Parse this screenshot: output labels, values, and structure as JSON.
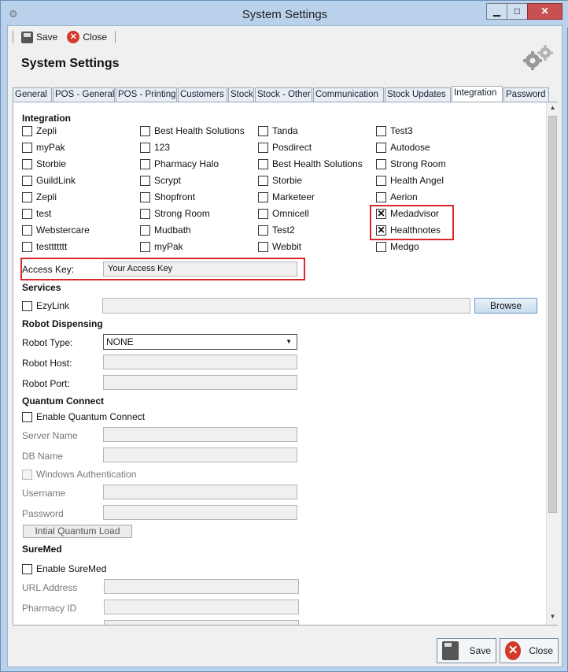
{
  "window": {
    "title": "System Settings"
  },
  "toolbar": {
    "save_label": "Save",
    "close_label": "Close"
  },
  "header": {
    "title": "System Settings"
  },
  "tabs": [
    "General",
    "POS - General",
    "POS - Printing",
    "Customers",
    "Stock",
    "Stock - Other",
    "Communication",
    "Stock Updates",
    "Integration",
    "Password"
  ],
  "active_tab": "Integration",
  "integration": {
    "heading": "Integration",
    "columns": [
      [
        {
          "label": "Zepli",
          "checked": false
        },
        {
          "label": "myPak",
          "checked": false
        },
        {
          "label": "Storbie",
          "checked": false
        },
        {
          "label": "GuildLink",
          "checked": false
        },
        {
          "label": "Zepli",
          "checked": false
        },
        {
          "label": "test",
          "checked": false
        },
        {
          "label": "Webstercare",
          "checked": false
        },
        {
          "label": "testtttttt",
          "checked": false
        }
      ],
      [
        {
          "label": "Best Health Solutions",
          "checked": false
        },
        {
          "label": "123",
          "checked": false
        },
        {
          "label": "Pharmacy Halo",
          "checked": false
        },
        {
          "label": "Scrypt",
          "checked": false
        },
        {
          "label": "Shopfront",
          "checked": false
        },
        {
          "label": "Strong Room",
          "checked": false
        },
        {
          "label": "Mudbath",
          "checked": false
        },
        {
          "label": "myPak",
          "checked": false
        }
      ],
      [
        {
          "label": "Tanda",
          "checked": false
        },
        {
          "label": "Posdirect",
          "checked": false
        },
        {
          "label": "Best Health Solutions",
          "checked": false
        },
        {
          "label": "Storbie",
          "checked": false
        },
        {
          "label": "Marketeer",
          "checked": false
        },
        {
          "label": "Omnicell",
          "checked": false
        },
        {
          "label": "Test2",
          "checked": false
        },
        {
          "label": "Webbit",
          "checked": false
        }
      ],
      [
        {
          "label": "Test3",
          "checked": false
        },
        {
          "label": "Autodose",
          "checked": false
        },
        {
          "label": "Strong Room",
          "checked": false
        },
        {
          "label": "Health Angel",
          "checked": false
        },
        {
          "label": "Aerion",
          "checked": false
        },
        {
          "label": "Medadvisor",
          "checked": true
        },
        {
          "label": "Healthnotes",
          "checked": true
        },
        {
          "label": "Medgo",
          "checked": false
        }
      ]
    ],
    "access_key_label": "Access Key:",
    "access_key_value": "Your Access Key"
  },
  "services": {
    "heading": "Services",
    "ezylink_label": "EzyLink",
    "ezylink_checked": false,
    "ezylink_path": "",
    "browse_label": "Browse"
  },
  "robot": {
    "heading": "Robot Dispensing",
    "type_label": "Robot Type:",
    "type_value": "NONE",
    "host_label": "Robot Host:",
    "host_value": "",
    "port_label": "Robot Port:",
    "port_value": ""
  },
  "quantum": {
    "heading": "Quantum Connect",
    "enable_label": "Enable Quantum Connect",
    "enable_checked": false,
    "server_label": "Server Name",
    "db_label": "DB Name",
    "windows_auth_label": "Windows Authentication",
    "username_label": "Username",
    "password_label": "Password",
    "load_button": "Intial Quantum Load"
  },
  "suremed": {
    "heading": "SureMed",
    "enable_label": "Enable SureMed",
    "enable_checked": false,
    "url_label": "URL Address",
    "pharmacy_label": "Pharmacy ID"
  },
  "footer": {
    "save_label": "Save",
    "close_label": "Close"
  },
  "colors": {
    "highlight": "#d6282d",
    "titlebar": "#b9d1ea",
    "close_button": "#c75050"
  }
}
